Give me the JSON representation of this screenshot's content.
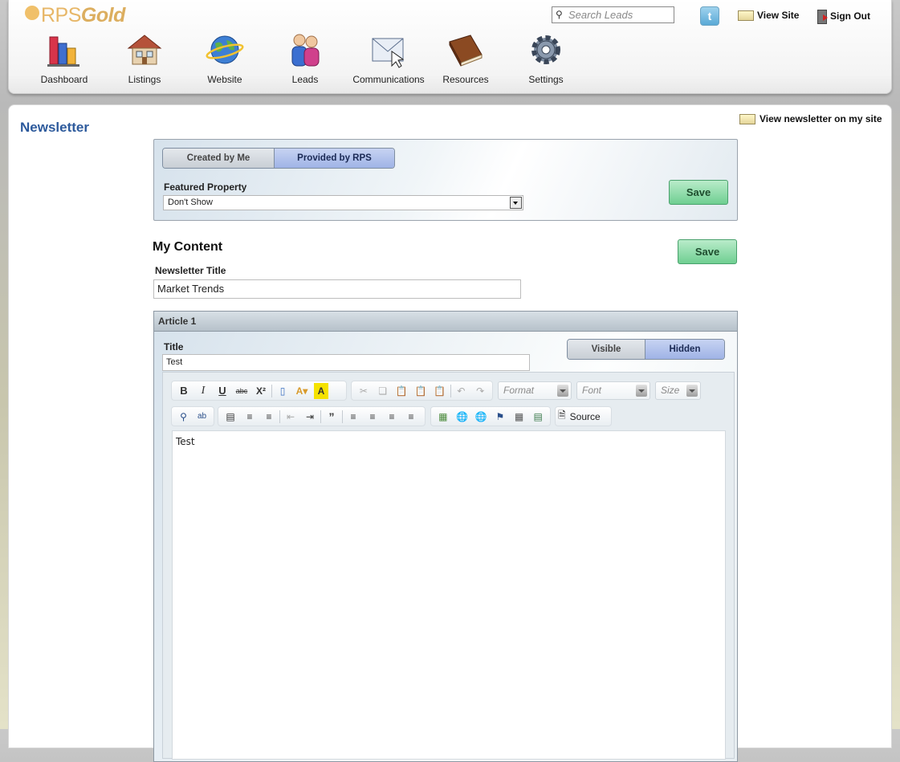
{
  "header": {
    "logo": {
      "prefix": "RPS",
      "suffix": "Gold"
    },
    "search": {
      "placeholder": "Search Leads"
    },
    "twitter": {
      "glyph": "t"
    },
    "view_site": "View Site",
    "sign_out": "Sign Out",
    "nav": [
      {
        "label": "Dashboard",
        "icon": "dashboard-icon"
      },
      {
        "label": "Listings",
        "icon": "house-icon"
      },
      {
        "label": "Website",
        "icon": "globe-icon"
      },
      {
        "label": "Leads",
        "icon": "people-icon"
      },
      {
        "label": "Communications",
        "icon": "envelope-icon"
      },
      {
        "label": "Resources",
        "icon": "book-icon"
      },
      {
        "label": "Settings",
        "icon": "gear-icon"
      }
    ]
  },
  "page": {
    "title": "Newsletter",
    "view_newsletter": "View newsletter on my site",
    "source_tabs": {
      "created_by_me": "Created by Me",
      "provided_by_rps": "Provided by RPS",
      "active": "Provided by RPS"
    },
    "featured_property": {
      "label": "Featured Property",
      "value": "Don't Show"
    },
    "save_label": "Save",
    "my_content": {
      "heading": "My Content",
      "save_label": "Save",
      "title_label": "Newsletter Title",
      "title_value": "Market Trends"
    },
    "article": {
      "header": "Article 1",
      "title_label": "Title",
      "title_value": "Test",
      "visibility": {
        "visible": "Visible",
        "hidden": "Hidden",
        "active": "Hidden"
      },
      "editor": {
        "format_placeholder": "Format",
        "font_placeholder": "Font",
        "size_placeholder": "Size",
        "source_label": "Source",
        "content": "Test"
      }
    }
  },
  "colors": {
    "title_blue": "#2d5a9c",
    "save_green": "#6fcf91",
    "active_tab": "#9fb3e6",
    "logo_gold": "#e7b768"
  }
}
